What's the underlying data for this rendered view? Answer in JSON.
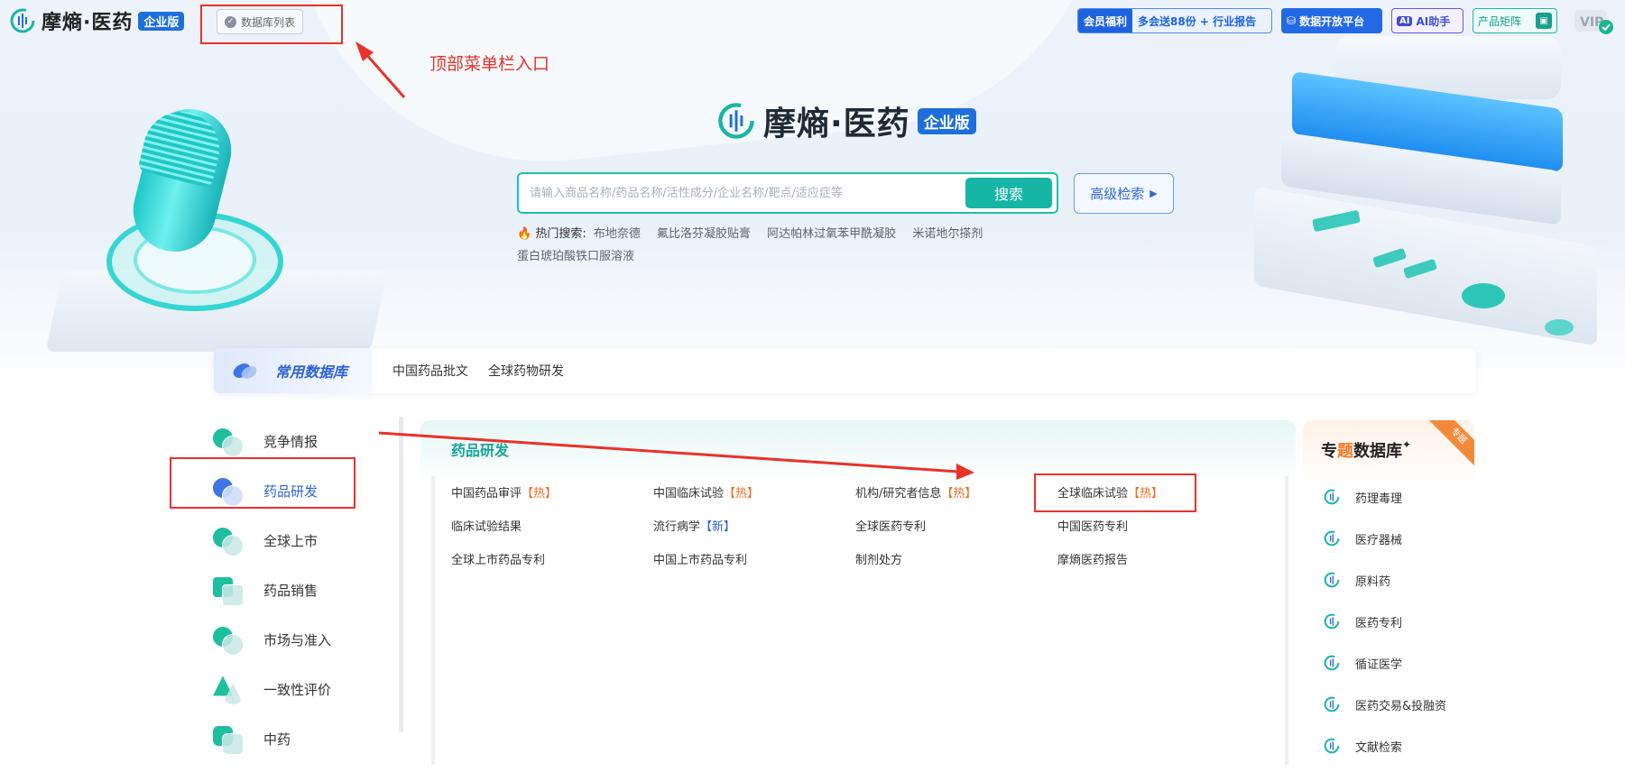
{
  "header": {
    "brand_name": "摩熵·医药",
    "brand_badge": "企业版",
    "db_list_label": "数据库列表",
    "promo_tag": "会员福利",
    "promo_text": "多会送88份 + 行业报告",
    "open_platform": "数据开放平台",
    "ai_icon": "AI",
    "ai_assistant": "AI助手",
    "product_matrix": "产品矩阵",
    "vip": "VIP"
  },
  "annotation": {
    "top_menu_label": "顶部菜单栏入口",
    "color": "#e8322a"
  },
  "hero": {
    "brand_name": "摩熵·医药",
    "brand_badge": "企业版",
    "search_placeholder": "请输入商品名称/药品名称/活性成分/企业名称/靶点/适应症等",
    "search_button": "搜索",
    "advanced_search": "高级检索",
    "hot_label": "热门搜索:",
    "hot_keywords": [
      "布地奈德",
      "氟比洛芬凝胶贴膏",
      "阿达帕林过氧苯甲酰凝胶",
      "米诺地尔搽剂",
      "蛋白琥珀酸铁口服溶液"
    ]
  },
  "tabbar": {
    "active_label": "常用数据库",
    "tabs": [
      "中国药品批文",
      "全球药物研发"
    ]
  },
  "leftnav": {
    "items": [
      "竞争情报",
      "药品研发",
      "全球上市",
      "药品销售",
      "市场与准入",
      "一致性评价",
      "中药"
    ],
    "active_index": 1
  },
  "panel": {
    "title": "药品研发",
    "items": [
      {
        "label": "中国药品审评",
        "tag": "【热】"
      },
      {
        "label": "中国临床试验",
        "tag": "【热】"
      },
      {
        "label": "机构/研究者信息",
        "tag": "【热】"
      },
      {
        "label": "全球临床试验",
        "tag": "【热】"
      },
      {
        "label": "临床试验结果",
        "tag": ""
      },
      {
        "label": "流行病学",
        "tag": "【新】"
      },
      {
        "label": "全球医药专利",
        "tag": ""
      },
      {
        "label": "中国医药专利",
        "tag": ""
      },
      {
        "label": "全球上市药品专利",
        "tag": ""
      },
      {
        "label": "中国上市药品专利",
        "tag": ""
      },
      {
        "label": "制剂处方",
        "tag": ""
      },
      {
        "label": "摩熵医药报告",
        "tag": ""
      }
    ]
  },
  "theme": {
    "title_pre": "专",
    "title_hl": "题",
    "title_post": "数据库",
    "ribbon": "专题",
    "items": [
      "药理毒理",
      "医疗器械",
      "原料药",
      "医药专利",
      "循证医学",
      "医药交易&投融资",
      "文献检索"
    ]
  },
  "colors": {
    "accent_teal": "#16b5a6",
    "accent_blue": "#2c63d3",
    "hot_orange": "#f26b1d"
  }
}
